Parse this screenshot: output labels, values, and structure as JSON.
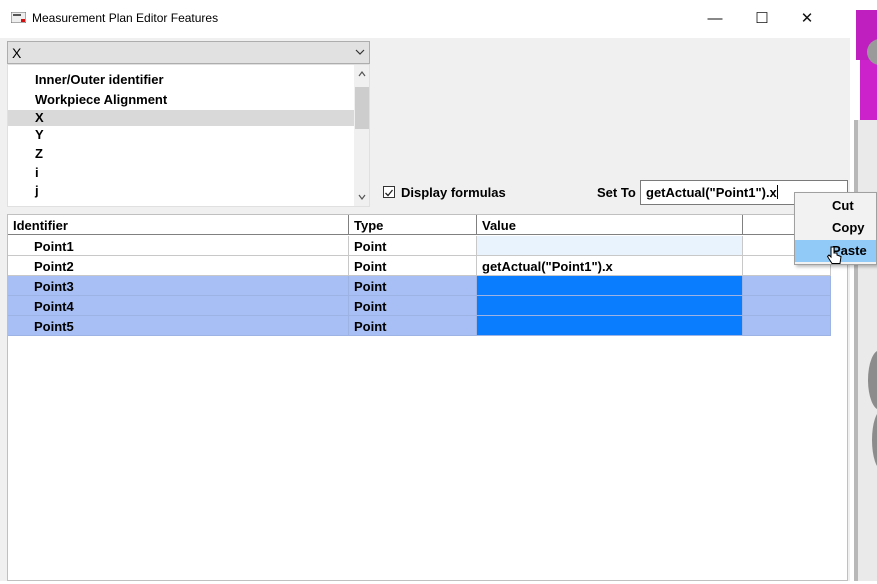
{
  "window": {
    "title": "Measurement Plan Editor Features",
    "min_icon": "minimize-icon",
    "max_icon": "maximize-icon",
    "close_icon": "close-icon",
    "min_glyph": "—",
    "max_glyph": "☐",
    "close_glyph": "✕"
  },
  "filter": {
    "selected": "X",
    "options": [
      "Inner/Outer identifier",
      "Workpiece Alignment",
      "X",
      "Y",
      "Z",
      "i",
      "j"
    ],
    "selected_index": 2
  },
  "display_formulas": {
    "label": "Display formulas",
    "checked": true
  },
  "set_to": {
    "label": "Set To",
    "value": "getActual(\"Point1\").x"
  },
  "grid": {
    "headers": {
      "identifier": "Identifier",
      "type": "Type",
      "value": "Value"
    },
    "rows": [
      {
        "identifier": "Point1",
        "type": "Point",
        "value": "",
        "selected": false
      },
      {
        "identifier": "Point2",
        "type": "Point",
        "value": "getActual(\"Point1\").x",
        "selected": false
      },
      {
        "identifier": "Point3",
        "type": "Point",
        "value": "",
        "selected": true
      },
      {
        "identifier": "Point4",
        "type": "Point",
        "value": "",
        "selected": true
      },
      {
        "identifier": "Point5",
        "type": "Point",
        "value": "",
        "selected": true
      }
    ]
  },
  "context_menu": {
    "items": [
      "Cut",
      "Copy",
      "Paste"
    ],
    "highlighted": "Paste"
  },
  "colors": {
    "selected_row": "#a7bff5",
    "selected_value": "#0a7dff",
    "menu_highlight": "#91c9f7"
  }
}
